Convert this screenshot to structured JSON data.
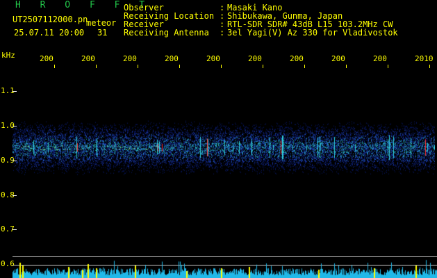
{
  "header": {
    "title": "H R O F F T",
    "file_name": "UT2507112000.pn",
    "mode_label": "meteor",
    "date_time": "25.07.11 20:00",
    "count": "31"
  },
  "info": {
    "observer_label": "Observer",
    "observer_value": "Masaki Kano",
    "location_label": "Receiving Location",
    "location_value": "Shibukawa, Gunma, Japan",
    "receiver_label": "Receiver",
    "receiver_value": "RTL-SDR SDR# 43dB L15 103.2MHz CW",
    "antenna_label": "Receiving Antenna",
    "antenna_value": "3el Yagi(V) Az 330 for Vladivostok",
    "separator": ":"
  },
  "axis": {
    "y_unit": "kHz",
    "y_labels": [
      "1.1",
      "1.0",
      "0.9",
      "0.8",
      "0.7",
      "0.6"
    ],
    "x_labels": [
      "200",
      "200",
      "200",
      "200",
      "200",
      "200",
      "200",
      "200",
      "200",
      "2010"
    ]
  },
  "spectrogram": {
    "band_center_khz": 0.92,
    "band_half_width_khz": 0.06,
    "y_range_khz": [
      0.59,
      1.16
    ],
    "background": "#000000",
    "band_colors": [
      "#0a1a6e",
      "#1f3fc8",
      "#2e7dff",
      "#2fd0e0",
      "#8fe07a",
      "#ff3030"
    ]
  },
  "colors": {
    "text_yellow": "#ffff00",
    "title_green": "#22c64a",
    "bars_cyan": "#20b8e8",
    "bars_yellow": "#ffff00"
  }
}
